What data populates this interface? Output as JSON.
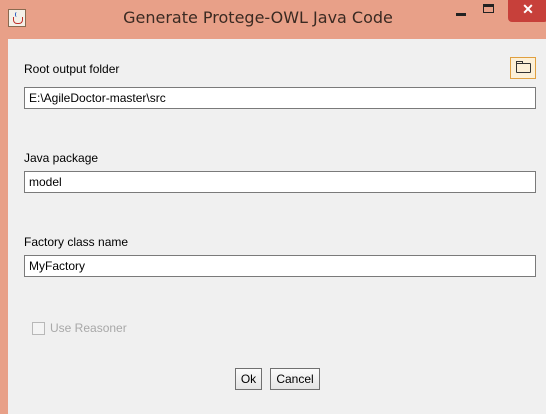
{
  "window": {
    "title": "Generate Protege-OWL Java Code",
    "controls": {
      "minimize": "–",
      "maximize": "□",
      "close": "✕"
    }
  },
  "form": {
    "root_output_folder": {
      "label": "Root output folder",
      "value": "E:\\AgileDoctor-master\\src",
      "browse_icon": "folder-icon"
    },
    "java_package": {
      "label": "Java package",
      "value": "model"
    },
    "factory_class_name": {
      "label": "Factory class name",
      "value": "MyFactory"
    },
    "use_reasoner": {
      "label": "Use Reasoner",
      "checked": false,
      "enabled": false
    }
  },
  "buttons": {
    "ok": "Ok",
    "cancel": "Cancel"
  },
  "colors": {
    "titlebar": "#e8a088",
    "close_button": "#c7403a",
    "content_background": "#f0f0f0",
    "browse_highlight": "#e0a040"
  }
}
